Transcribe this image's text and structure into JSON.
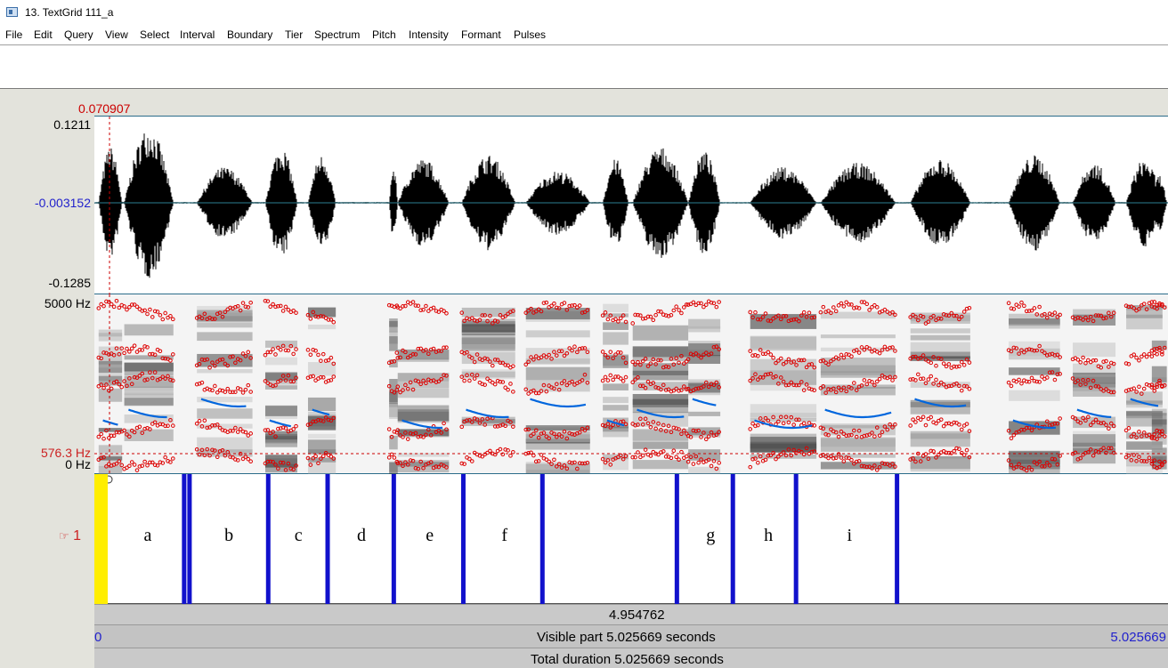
{
  "window": {
    "title": "13. TextGrid 111_a"
  },
  "menu": [
    "File",
    "Edit",
    "Query",
    "View",
    "Select",
    "Interval",
    "Boundary",
    "Tier",
    "Spectrum",
    "Pitch",
    "Intensity",
    "Formant",
    "Pulses"
  ],
  "cursor": {
    "time_label": "0.070907",
    "time": 0.070907
  },
  "waveform": {
    "max_label": "0.1211",
    "cursor_value_label": "-0.003152",
    "min_label": "-0.1285"
  },
  "spectrogram": {
    "top_label": "5000 Hz",
    "cursor_freq_label": "576.3 Hz",
    "bottom_label": "0 Hz"
  },
  "tier": {
    "number": "1",
    "boundaries": [
      0.0185,
      0.4203,
      0.4455,
      0.8138,
      1.0919,
      1.4016,
      1.7271,
      2.0973,
      2.7268,
      2.9888,
      3.2845,
      3.7572
    ],
    "intervals": [
      {
        "label": "a",
        "center": 0.25
      },
      {
        "label": "b",
        "center": 0.63
      },
      {
        "label": "c",
        "center": 0.955
      },
      {
        "label": "d",
        "center": 1.25
      },
      {
        "label": "e",
        "center": 1.57
      },
      {
        "label": "f",
        "center": 1.92
      },
      {
        "label": "g",
        "center": 2.885
      },
      {
        "label": "h",
        "center": 3.155
      },
      {
        "label": "i",
        "center": 3.535
      }
    ]
  },
  "footer": {
    "selection_duration": "4.954762",
    "visible_start": "0",
    "visible_part": "Visible part 5.025669 seconds",
    "visible_end": "5.025669",
    "total_duration": "Total duration 5.025669 seconds"
  },
  "colors": {
    "cursor": "#cc0000",
    "pitch": "#0066dd",
    "formant": "#dd0000",
    "boundary": "#1111cc",
    "selected": "#ffee00"
  }
}
